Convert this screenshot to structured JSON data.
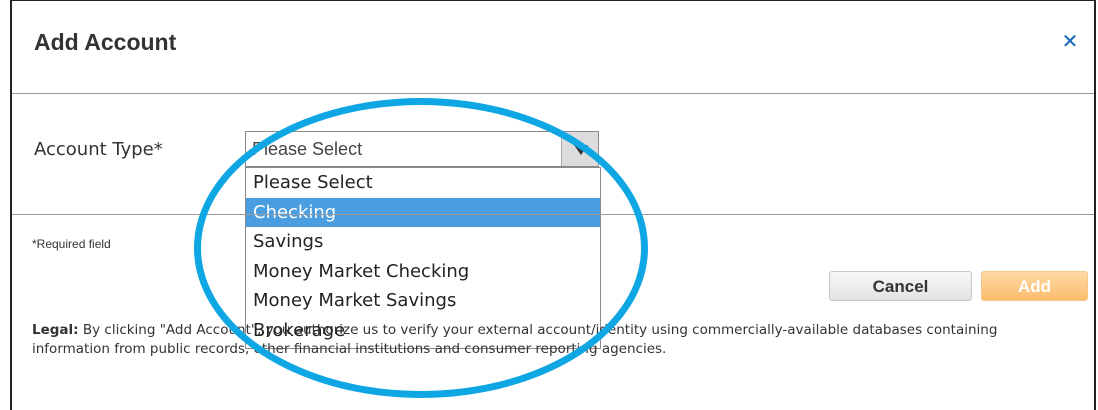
{
  "dialog": {
    "title": "Add Account",
    "close_icon": "close-icon",
    "close_glyph": "✕"
  },
  "account_type": {
    "label": "Account Type*",
    "selected_value": "Please Select",
    "options": [
      "Please Select",
      "Checking",
      "Savings",
      "Money Market Checking",
      "Money Market Savings",
      "Brokerage"
    ],
    "highlighted_option": "Checking"
  },
  "required_note": "*Required field",
  "buttons": {
    "cancel": "Cancel",
    "add": "Add"
  },
  "legal": {
    "label": "Legal:",
    "text": " By clicking \"Add Account\", you authorize us to verify your external account/identity using commercially-available databases containing information from public records, other financial institutions and consumer reporting agencies."
  },
  "colors": {
    "close_icon": "#1565b8",
    "highlight": "#4a9ee0",
    "annotation_circle": "#0ea7e4",
    "add_button": "#fbbd6c"
  }
}
